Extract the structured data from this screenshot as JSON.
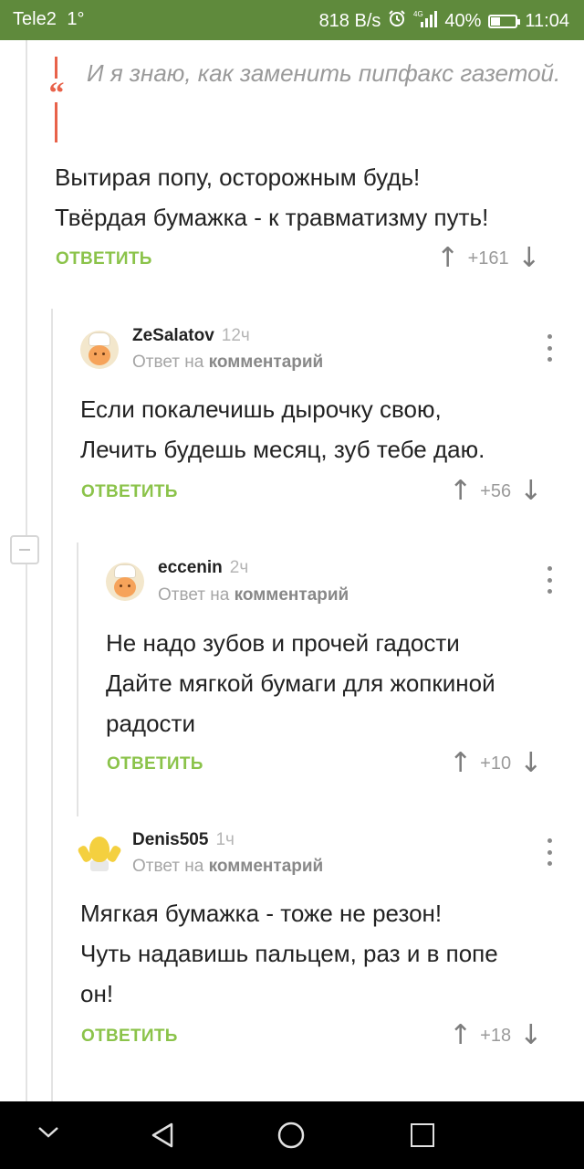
{
  "status_bar": {
    "carrier": "Tele2",
    "signal_note": "1°",
    "net_speed": "818 B/s",
    "network": "4G",
    "battery": "40%",
    "battery_level": 0.4,
    "time": "11:04",
    "alarm_icon": "alarm-clock-icon",
    "signal_icon": "signal-bars-icon"
  },
  "quote": {
    "text": "И я знаю, как заменить пипфакс газетой."
  },
  "comments": [
    {
      "lines": [
        "Вытирая попу, осторожным будь!",
        "Твёрдая бумажка - к травматизму путь!"
      ],
      "reply_label": "ОТВЕТИТЬ",
      "score": "+161"
    },
    {
      "author": "ZeSalatov",
      "time": "12ч",
      "reply_prefix": "Ответ на",
      "reply_target": "комментарий",
      "lines": [
        "Если покалечишь дырочку свою,",
        "Лечить будешь месяц, зуб тебе даю."
      ],
      "reply_label": "ОТВЕТИТЬ",
      "score": "+56"
    },
    {
      "author": "eccenin",
      "time": "2ч",
      "reply_prefix": "Ответ на",
      "reply_target": "комментарий",
      "lines": [
        "Не надо зубов и прочей гадости",
        "Дайте мягкой бумаги для жопкиной",
        "радости"
      ],
      "reply_label": "ОТВЕТИТЬ",
      "score": "+10"
    },
    {
      "author": "Denis505",
      "time": "1ч",
      "reply_prefix": "Ответ на",
      "reply_target": "комментарий",
      "lines": [
        "Мягкая бумажка - тоже не резон!",
        "Чуть надавишь пальцем, раз и в попе",
        "он!"
      ],
      "reply_label": "ОТВЕТИТЬ",
      "score": "+18"
    }
  ],
  "colors": {
    "status_bar": "#5f8a3c",
    "reply_green": "#8bc34a",
    "quote_red": "#e8624a"
  }
}
